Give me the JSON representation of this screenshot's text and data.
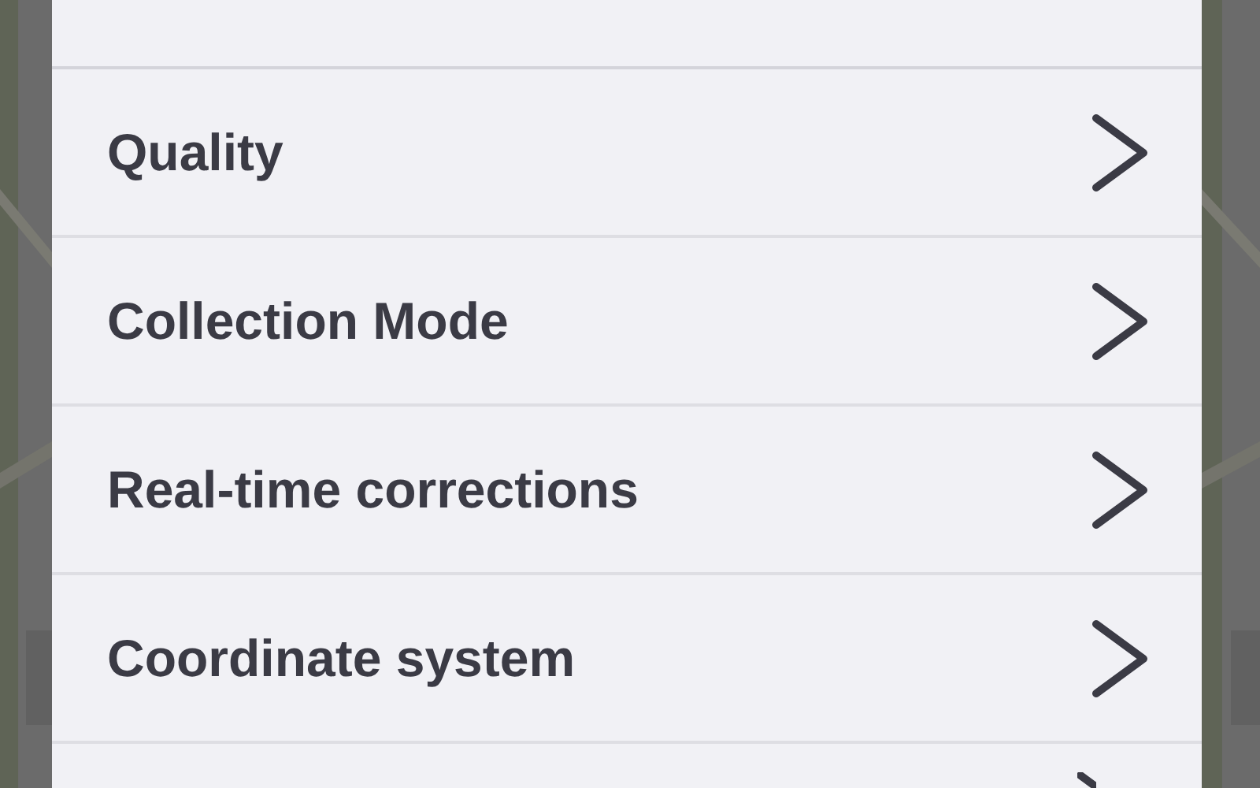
{
  "settings_menu": {
    "items": [
      {
        "label": "Quality"
      },
      {
        "label": "Collection Mode"
      },
      {
        "label": "Real-time corrections"
      },
      {
        "label": "Coordinate system"
      }
    ]
  }
}
